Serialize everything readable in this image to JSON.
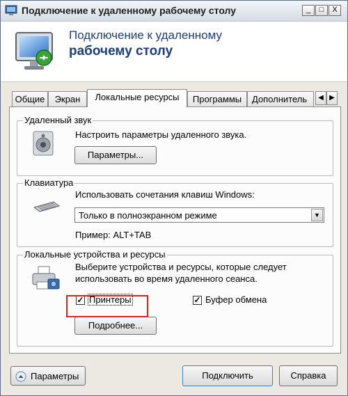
{
  "window": {
    "title": "Подключение к удаленному рабочему столу",
    "controls": {
      "minimize": "_",
      "maximize": "□",
      "close": "X"
    }
  },
  "header": {
    "line1": "Подключение к удаленному",
    "line2": "рабочему столу"
  },
  "tabs": {
    "items": [
      {
        "label": "Общие"
      },
      {
        "label": "Экран"
      },
      {
        "label": "Локальные ресурсы"
      },
      {
        "label": "Программы"
      },
      {
        "label": "Дополнитель"
      }
    ],
    "active": "Локальные ресурсы",
    "scroll_left": "◀",
    "scroll_right": "▶"
  },
  "sound": {
    "title": "Удаленный звук",
    "description": "Настроить параметры удаленного звука.",
    "button": "Параметры..."
  },
  "keyboard": {
    "title": "Клавиатура",
    "description": "Использовать сочетания клавиш Windows:",
    "selected": "Только в полноэкранном режиме",
    "example": "Пример: ALT+TAB"
  },
  "devices": {
    "title": "Локальные устройства и ресурсы",
    "description_line1": "Выберите устройства и ресурсы, которые следует",
    "description_line2": "использовать во время удаленного сеанса.",
    "printers": {
      "label": "Принтеры",
      "checked": true
    },
    "clipboard": {
      "label": "Буфер обмена",
      "checked": true
    },
    "more_button": "Подробнее..."
  },
  "footer": {
    "options_button": "Параметры",
    "connect_button": "Подключить",
    "help_button": "Справка"
  },
  "icons": {
    "app": "remote-desktop-icon",
    "sound": "speaker-icon",
    "keyboard": "keyboard-icon",
    "devices": "printer-camera-icon"
  },
  "colors": {
    "header_text": "#1c3e78",
    "highlight": "#e02020"
  }
}
